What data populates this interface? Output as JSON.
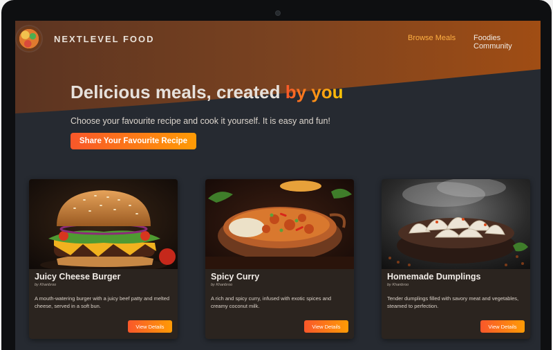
{
  "header": {
    "brand": "NEXTLEVEL FOOD",
    "logo_icon": "food-plate-logo",
    "nav": [
      "Browse Meals",
      "Foodies Community"
    ]
  },
  "hero": {
    "title_main": "Delicious meals, created ",
    "title_accent": "by you",
    "subtitle": "Choose your favourite recipe and cook it yourself. It is easy and fun!",
    "cta": "Share Your Favourite Recipe"
  },
  "meals": [
    {
      "title": "Juicy Cheese Burger",
      "author": "by Khanbroo",
      "summary": "A mouth-watering burger with a juicy beef patty and melted cheese, served in a soft bun.",
      "button": "View Details"
    },
    {
      "title": "Spicy Curry",
      "author": "by Khanbroo",
      "summary": "A rich and spicy curry, infused with exotic spices and creamy coconut milk.",
      "button": "View Details"
    },
    {
      "title": "Homemade Dumplings",
      "author": "by Khanbroo",
      "summary": "Tender dumplings filled with savory meat and vegetables, steamed to perfection.",
      "button": "View Details"
    }
  ],
  "colors": {
    "accent_start": "#f9572a",
    "accent_end": "#ffc905",
    "background": "#262a31",
    "card": "#2b241f"
  }
}
